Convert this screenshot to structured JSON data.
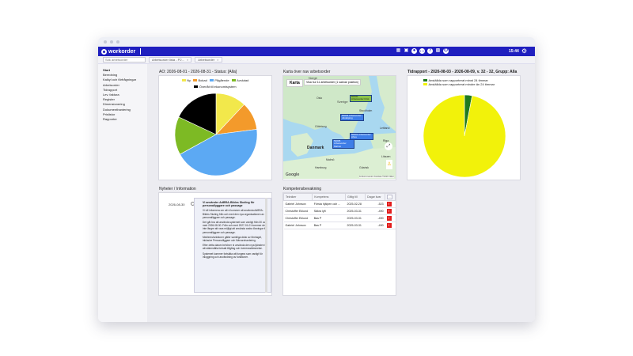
{
  "app": {
    "logo_text": "workorder",
    "time": "15:44"
  },
  "toolbar_icons": [
    "calendar-icon",
    "save-icon",
    "user-icon",
    "chat-icon",
    "help-icon",
    "grid-icon",
    "logout-icon"
  ],
  "tabs": {
    "search_placeholder": "Sök arbetsorder",
    "items": [
      {
        "label": "Arbetsorder lista - P2...",
        "close": "×"
      },
      {
        "label": "Arbetsorder",
        "close": "×"
      }
    ]
  },
  "sidebar": {
    "items": [
      {
        "label": "Start",
        "active": true
      },
      {
        "label": "Beredning"
      },
      {
        "label": "Kalkyl och förfrågningar"
      },
      {
        "label": "Arbetsorder"
      },
      {
        "label": "Tidrapport"
      },
      {
        "label": "Lev. faktura"
      },
      {
        "label": "Register"
      },
      {
        "label": "Dimensionering"
      },
      {
        "label": "Dokumenthantering"
      },
      {
        "label": "Prislistor"
      },
      {
        "label": "Rapporter"
      }
    ]
  },
  "ao_panel": {
    "title": "AO: 2026-08-01 - 2026-08-31 - Status: [Alla]",
    "legend": [
      {
        "label": "Ny",
        "color": "#f2e84b"
      },
      {
        "label": "Bokad",
        "color": "#f39a2b"
      },
      {
        "label": "Pågående",
        "color": "#5ca9f3"
      },
      {
        "label": "Avslutad",
        "color": "#7dba24"
      },
      {
        "label": "Överlåt till ekonomisystem",
        "color": "#000000"
      }
    ],
    "chart_data": {
      "type": "pie",
      "title": "AO: 2026-08-01 - 2026-08-31 - Status: [Alla]",
      "labels": [
        "Ny",
        "Bokad",
        "Pågående",
        "Avslutad",
        "Överlåt till ekonomisystem"
      ],
      "values": [
        12,
        11,
        44,
        15,
        18
      ],
      "colors": [
        "#f2e84b",
        "#f39a2b",
        "#5ca9f3",
        "#7dba24",
        "#000000"
      ]
    }
  },
  "map_panel": {
    "title": "Karta över nav arbetsorder",
    "map_button": "Karta",
    "info_text": "Visa hur 11 arbetsorder (1 saknar position)",
    "labels": [
      "Norge",
      "Sverige",
      "Danmark",
      "Oslo",
      "Göteborg",
      "Malmö",
      "Hamburg",
      "Stockholm",
      "Riga",
      "Gdańsk",
      "Litauen",
      "Lettland"
    ],
    "google": "Google",
    "footer": "Kortkommandon  Kartdata ©2026  Villkor",
    "tags": [
      {
        "text": "50000 Arbetsorder Frist",
        "green": true
      },
      {
        "text": "50004 Arbetsorder Jönköping",
        "green": false
      },
      {
        "text": "50001 Arbetsorder Ahus",
        "green": false
      },
      {
        "text": "50005 Arbetsorder Malmö",
        "green": false
      }
    ]
  },
  "time_panel": {
    "title": "Tidrapport - 2026-08-03 - 2026-08-09, v. 32 - 32, Grupp: Alla",
    "legend": [
      {
        "label": "Anställda som rapporterat minst 24 timmar",
        "color": "#1f7a1f"
      },
      {
        "label": "Anställda som rapporterat mindre än 24 timmar",
        "color": "#f2f20a"
      }
    ],
    "chart_data": {
      "type": "pie",
      "title": "Tidrapport - 2026-08-03 - 2026-08-09, v. 32 - 32, Grupp: Alla",
      "labels": [
        "Anställda som rapporterat minst 24 timmar",
        "Anställda som rapporterat mindre än 24 timmar"
      ],
      "values": [
        3,
        97
      ],
      "colors": [
        "#1f7a1f",
        "#f2f20a"
      ]
    }
  },
  "news_panel": {
    "title": "Nyheter / Information",
    "date": "2026-08-30",
    "headline": "Vi använder AdBRA-Bildes Skoling för personallyggare och passage",
    "paragraphs": [
      "Vi vill informera om att vi kommer att använda AdBRA-Bildes Skoling från och med den nya organisationen av personalliggare och passage.",
      "Det går bra att använda systemet som vanligt från 30 och med 2026-08-30. Från och med 2027-01-01 kommer det inte längre att vara möjligt att använda andra lösningar för personalliggare och passage.",
      "Medlemsfunktioner gäller samtliga delar av företaget, inklusive Personalliggare och Närvarohantering.",
      "Efter detta datum behöver ni använda den nya tjänsten för att säkerställa fortsatt tillgång och överensstämmelse.",
      "Systemet kommer fortsätta att fungera som vanligt för inloggning och användning av funktioner."
    ]
  },
  "competence_panel": {
    "title": "Kompetensbevakning",
    "columns": [
      "Tekniker",
      "Kompetens",
      "Giltig till",
      "Dagar kvar"
    ],
    "more": "...",
    "rows": [
      {
        "tech": "Gabriel Johnson",
        "comp": "Första hjälpen och ...",
        "date": "2025-02-28",
        "days": "-523"
      },
      {
        "tech": "Christoffer Eklund",
        "comp": "Säkra lyft",
        "date": "2025-03-31",
        "days": "-490"
      },
      {
        "tech": "Christoffer Eklund",
        "comp": "Bas P",
        "date": "2025-03-31",
        "days": "-490"
      },
      {
        "tech": "Gabriel Johnson",
        "comp": "Bas P",
        "date": "2025-03-31",
        "days": "-490"
      }
    ],
    "warn_symbol": "!"
  }
}
